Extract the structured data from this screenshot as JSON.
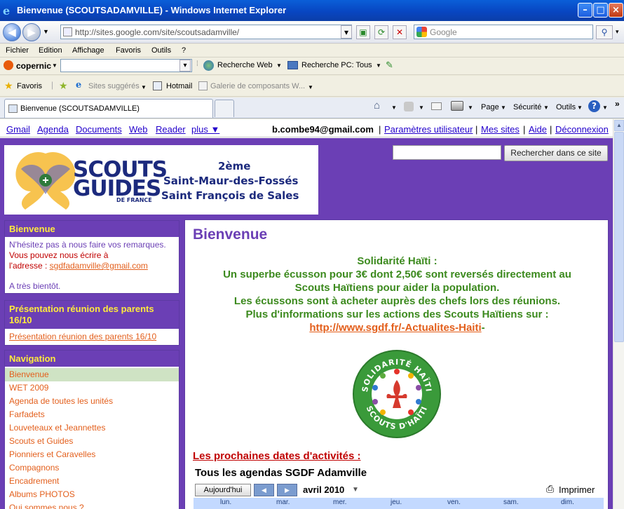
{
  "window": {
    "title": "Bienvenue (SCOUTSADAMVILLE) - Windows Internet Explorer",
    "url": "http://sites.google.com/site/scoutsadamville/",
    "search_placeholder": "Google"
  },
  "menu": [
    "Fichier",
    "Edition",
    "Affichage",
    "Favoris",
    "Outils",
    "?"
  ],
  "copernic": {
    "logo": "copernic",
    "web_search": "Recherche Web",
    "pc_search": "Recherche PC: Tous"
  },
  "favorites": {
    "label": "Favoris",
    "suggested": "Sites suggérés",
    "hotmail": "Hotmail",
    "gallery": "Galerie de composants W..."
  },
  "tab": {
    "title": "Bienvenue (SCOUTSADAMVILLE)",
    "commands": [
      "Page",
      "Sécurité",
      "Outils"
    ]
  },
  "gbar": {
    "links": [
      "Gmail",
      "Agenda",
      "Documents",
      "Web",
      "Reader",
      "plus ▼"
    ],
    "email": "b.combe94@gmail.com",
    "right_links": [
      "Paramètres utilisateur",
      "Mes sites",
      "Aide",
      "Déconnexion"
    ]
  },
  "banner": {
    "logo_line1": "SCOUTS",
    "logo_line2": "GUIDES",
    "logo_line3": "DE FRANCE",
    "line1": "2ème",
    "line2": "Saint-Maur-des-Fossés",
    "line3": "Saint François de Sales"
  },
  "site_search_button": "Rechercher dans ce site",
  "sidebar": {
    "welcome": {
      "title": "Bienvenue",
      "text1": "N'hésitez pas à nous faire vos remarques.",
      "text2": "Vous pouvez nous écrire à",
      "text3": "l'adresse : ",
      "email": "sgdfadamville@gmail.com",
      "text4": "A très bientôt."
    },
    "meeting": {
      "title": "Présentation réunion des parents 16/10",
      "link": "Présentation réunion des parents 16/10"
    },
    "navigation": {
      "title": "Navigation",
      "items": [
        "Bienvenue",
        "WET 2009",
        "Agenda de toutes les unités",
        "Farfadets",
        "Louveteaux et Jeannettes",
        "Scouts et Guides",
        "Pionniers et Caravelles",
        "Compagnons",
        "Encadrement",
        "Albums PHOTOS",
        "Qui sommes nous ?"
      ]
    }
  },
  "main": {
    "title": "Bienvenue",
    "lines": [
      "Solidarité Haïti :",
      "Un superbe écusson pour 3€ dont 2,50€ sont reversés directement au",
      "Scouts Haïtiens pour aider la population.",
      "Les écussons sont à acheter auprès des chefs lors des réunions.",
      "Plus d'informations sur les actions des Scouts Haïtiens sur :"
    ],
    "link": "http://www.sgdf.fr/-Actualites-Haiti",
    "link_suffix": "-",
    "badge_top": "SOLIDARITÉ HAÏTI",
    "badge_bottom": "SCOUTS D'HAÏTI",
    "dates_heading": "Les prochaines dates d'activités :",
    "calendar": {
      "title": "Tous les agendas SGDF Adamville",
      "today": "Aujourd'hui",
      "month": "avril 2010",
      "print": "Imprimer",
      "days": [
        "lun.",
        "mar.",
        "mer.",
        "jeu.",
        "ven.",
        "sam.",
        "dim."
      ]
    }
  },
  "colors": {
    "purple": "#6b3fb5",
    "sidebar_heading": "#ffeb3b",
    "orange_link": "#e35f1c",
    "green_text": "#3c8a1e",
    "red_heading": "#c00000"
  }
}
